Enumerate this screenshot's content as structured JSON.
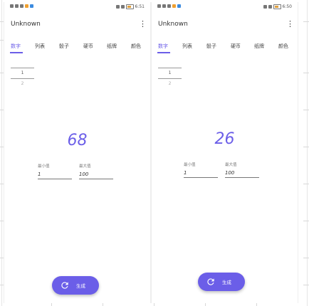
{
  "screens": [
    {
      "status": {
        "time": "6:51"
      },
      "app_title": "Unknown",
      "tabs": [
        "数字",
        "列表",
        "骰子",
        "硬币",
        "纸牌",
        "颜色"
      ],
      "active_tab": 0,
      "history": [
        "1",
        "2"
      ],
      "result": "68",
      "min": {
        "label": "最小值",
        "value": "1"
      },
      "max": {
        "label": "最大值",
        "value": "100"
      },
      "generate_label": "生成"
    },
    {
      "status": {
        "time": "6:50"
      },
      "app_title": "Unknown",
      "tabs": [
        "数字",
        "列表",
        "骰子",
        "硬币",
        "纸牌",
        "颜色"
      ],
      "active_tab": 0,
      "history": [
        "1",
        "2"
      ],
      "result": "26",
      "min": {
        "label": "最小值",
        "value": "1"
      },
      "max": {
        "label": "最大值",
        "value": "100"
      },
      "generate_label": "生成"
    }
  ],
  "colors": {
    "accent": "#6b5ee8",
    "text": "#333333"
  },
  "icons": {
    "menu": "more-vert-icon",
    "refresh": "refresh-icon"
  }
}
